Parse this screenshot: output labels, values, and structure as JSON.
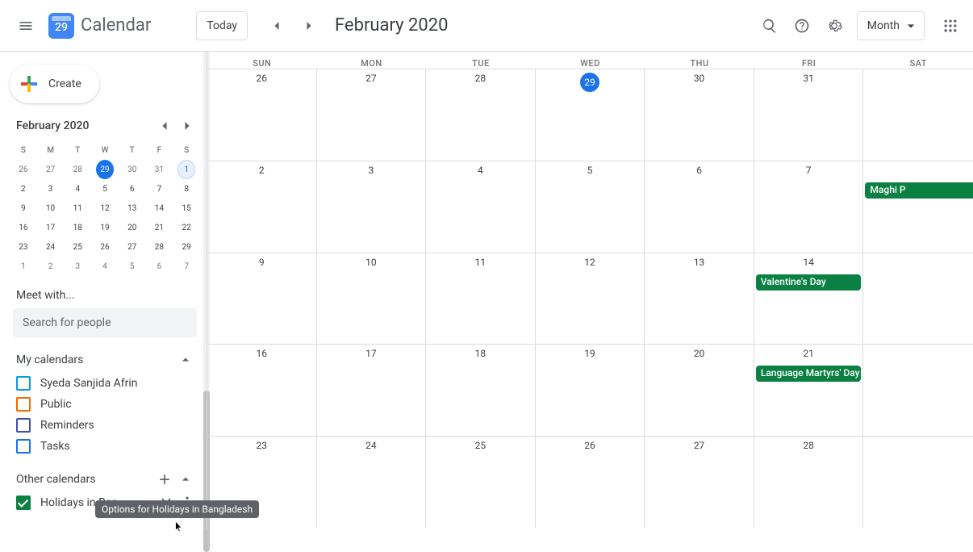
{
  "header": {
    "logo_day": "29",
    "app_title": "Calendar",
    "today_label": "Today",
    "current_date": "February 2020",
    "view_label": "Month"
  },
  "create_label": "Create",
  "mini": {
    "title": "February 2020",
    "dow": [
      "S",
      "M",
      "T",
      "W",
      "T",
      "F",
      "S"
    ],
    "rows": [
      [
        "26",
        "27",
        "28",
        "29",
        "30",
        "31",
        "1"
      ],
      [
        "2",
        "3",
        "4",
        "5",
        "6",
        "7",
        "8"
      ],
      [
        "9",
        "10",
        "11",
        "12",
        "13",
        "14",
        "15"
      ],
      [
        "16",
        "17",
        "18",
        "19",
        "20",
        "21",
        "22"
      ],
      [
        "23",
        "24",
        "25",
        "26",
        "27",
        "28",
        "29"
      ],
      [
        "1",
        "2",
        "3",
        "4",
        "5",
        "6",
        "7"
      ]
    ]
  },
  "meet_label": "Meet with...",
  "search_placeholder": "Search for people",
  "my_calendars_label": "My calendars",
  "my_calendars": [
    {
      "label": "Syeda Sanjida Afrin",
      "color": "#039be5",
      "checked": false
    },
    {
      "label": "Public",
      "color": "#ef6c00",
      "checked": false
    },
    {
      "label": "Reminders",
      "color": "#3f51b5",
      "checked": false
    },
    {
      "label": "Tasks",
      "color": "#1a73e8",
      "checked": false
    }
  ],
  "other_calendars_label": "Other calendars",
  "other_calendars": [
    {
      "label": "Holidays in Ban...",
      "color": "#0b8043",
      "checked": true
    }
  ],
  "tooltip_text": "Options for Holidays in Bangladesh",
  "grid": {
    "dow": [
      "SUN",
      "MON",
      "TUE",
      "WED",
      "THU",
      "FRI",
      "SAT"
    ],
    "weeks": [
      {
        "days": [
          "26",
          "27",
          "28",
          "29",
          "30",
          "31",
          ""
        ],
        "today_idx": 3
      },
      {
        "days": [
          "2",
          "3",
          "4",
          "5",
          "6",
          "7",
          ""
        ],
        "events": [
          {
            "col": 6,
            "label": "Maghi P",
            "wide": true
          }
        ]
      },
      {
        "days": [
          "9",
          "10",
          "11",
          "12",
          "13",
          "14",
          ""
        ],
        "events": [
          {
            "col": 5,
            "label": "Valentine's Day"
          }
        ]
      },
      {
        "days": [
          "16",
          "17",
          "18",
          "19",
          "20",
          "21",
          ""
        ],
        "events": [
          {
            "col": 5,
            "label": "Language Martyrs' Day"
          }
        ]
      },
      {
        "days": [
          "23",
          "24",
          "25",
          "26",
          "27",
          "28",
          ""
        ]
      }
    ]
  }
}
